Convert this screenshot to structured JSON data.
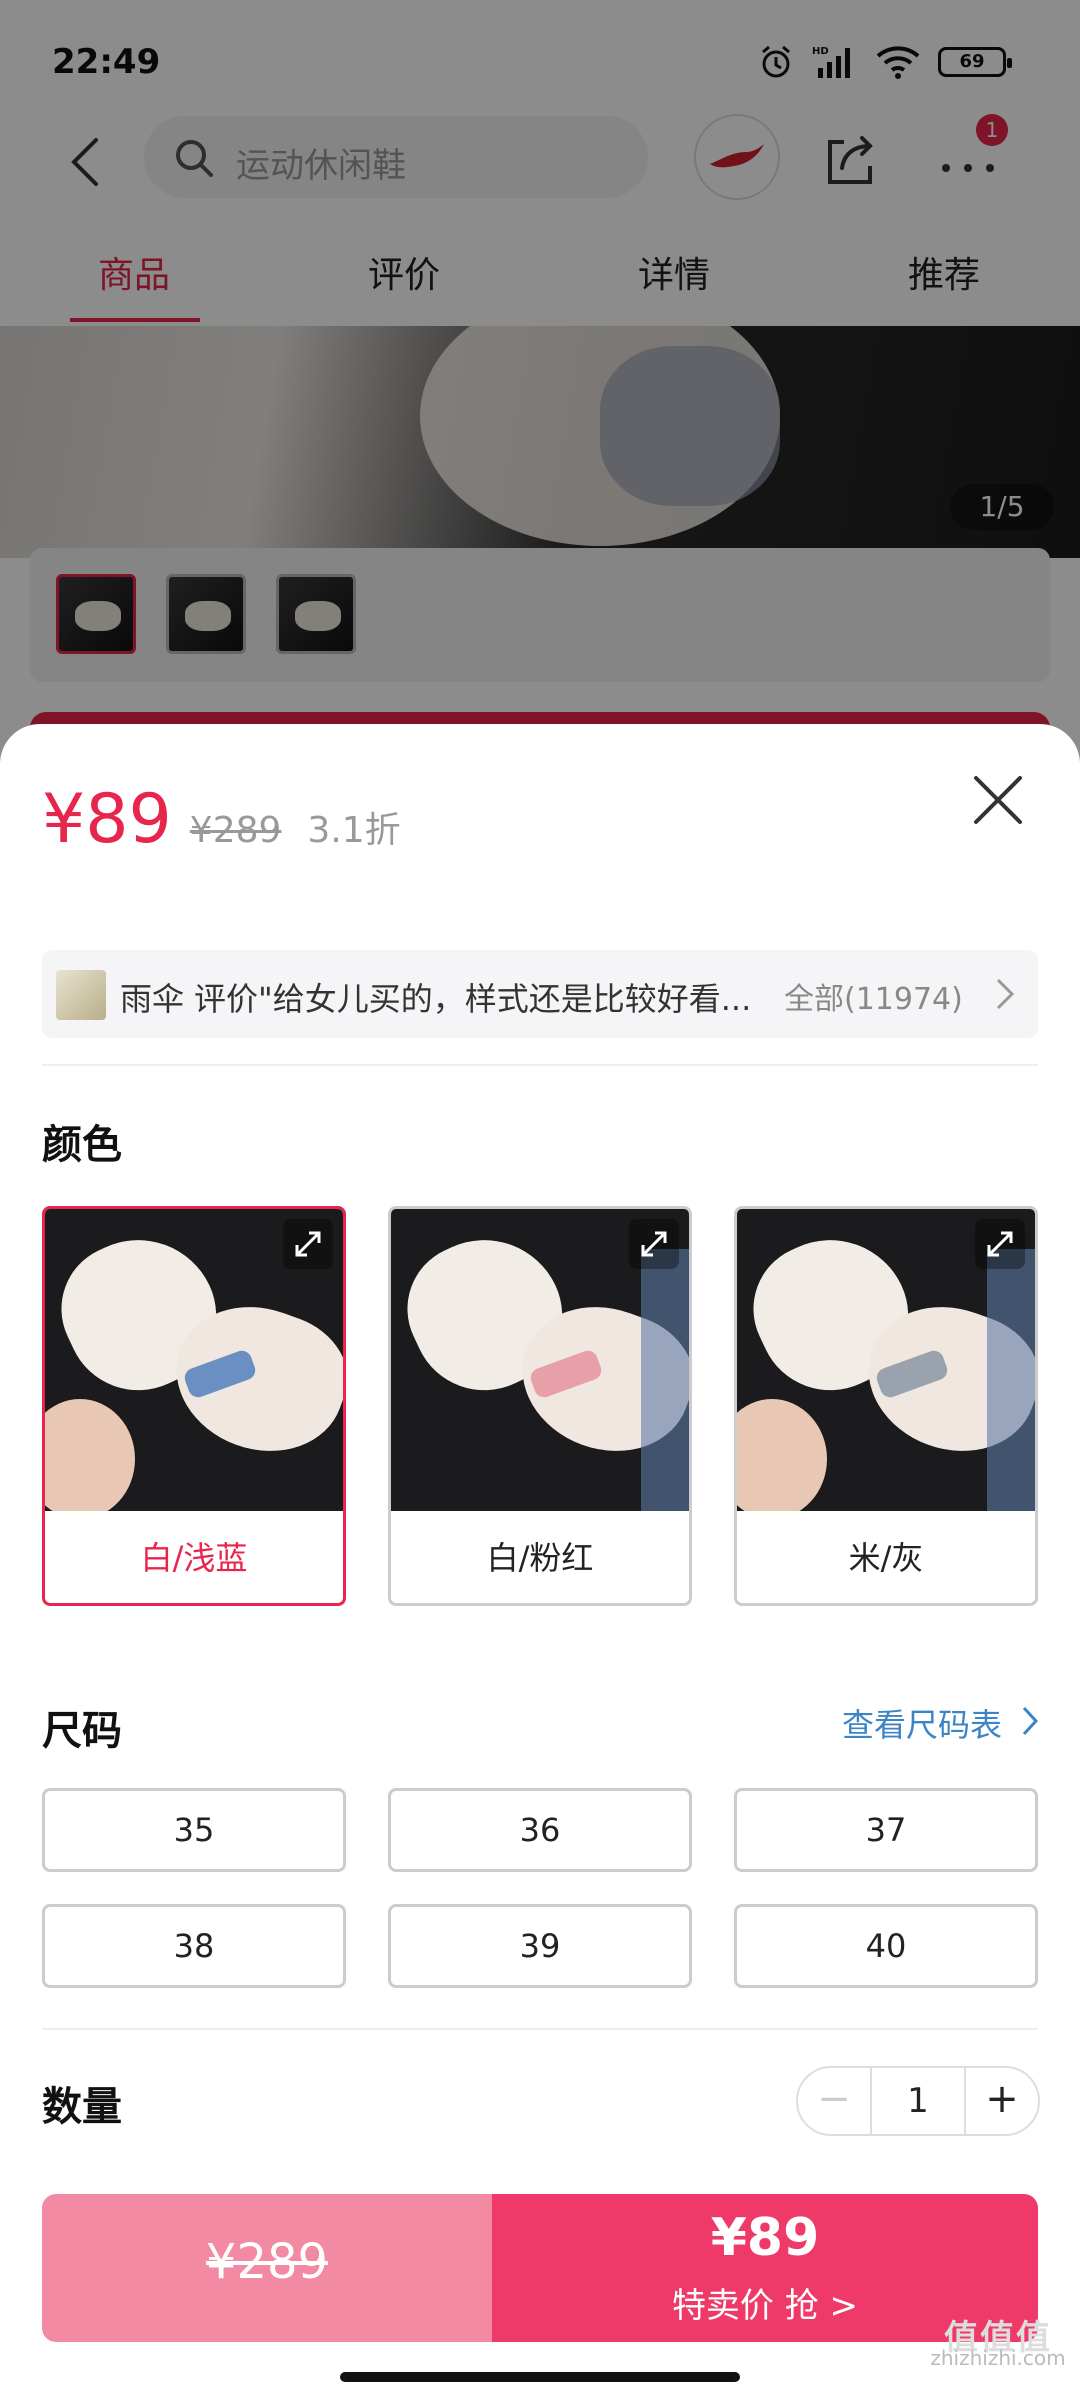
{
  "status_bar": {
    "time": "22:49",
    "battery": "69"
  },
  "topbar": {
    "search_placeholder": "运动休闲鞋",
    "more_badge": "1"
  },
  "tabs": [
    {
      "label": "商品",
      "active": true
    },
    {
      "label": "评价",
      "active": false
    },
    {
      "label": "详情",
      "active": false
    },
    {
      "label": "推荐",
      "active": false
    }
  ],
  "gallery": {
    "page_indicator": "1/5",
    "thumbnail_count": 3,
    "selected_thumbnail": 1
  },
  "sheet": {
    "price_current": "¥89",
    "price_original": "¥289",
    "discount": "3.1折",
    "review": {
      "user": "雨伞",
      "text": "评价\"给女儿买的，样式还是比较好看...",
      "all_label": "全部(11974)"
    },
    "color_title": "颜色",
    "colors": [
      {
        "label": "白/浅蓝",
        "selected": true,
        "accent": "#6a8fc2"
      },
      {
        "label": "白/粉红",
        "selected": false,
        "accent": "#e7a0a8"
      },
      {
        "label": "米/灰",
        "selected": false,
        "accent": "#9aa2ad"
      }
    ],
    "size_title": "尺码",
    "size_chart_link": "查看尺码表",
    "sizes": [
      "35",
      "36",
      "37",
      "38",
      "39",
      "40"
    ],
    "quantity_title": "数量",
    "quantity": {
      "minus": "−",
      "value": "1",
      "plus": "+"
    },
    "buy_bar": {
      "left_price": "¥289",
      "right_price": "¥89",
      "right_label": "特卖价 抢 >"
    }
  },
  "colors": {
    "accent": "#e8254c",
    "buy_left_bg": "#f38aa4",
    "buy_right_bg": "#ef3a69",
    "link": "#3d84c6"
  },
  "watermark": {
    "logo": "值值值",
    "site": "zhizhizhi.com"
  }
}
